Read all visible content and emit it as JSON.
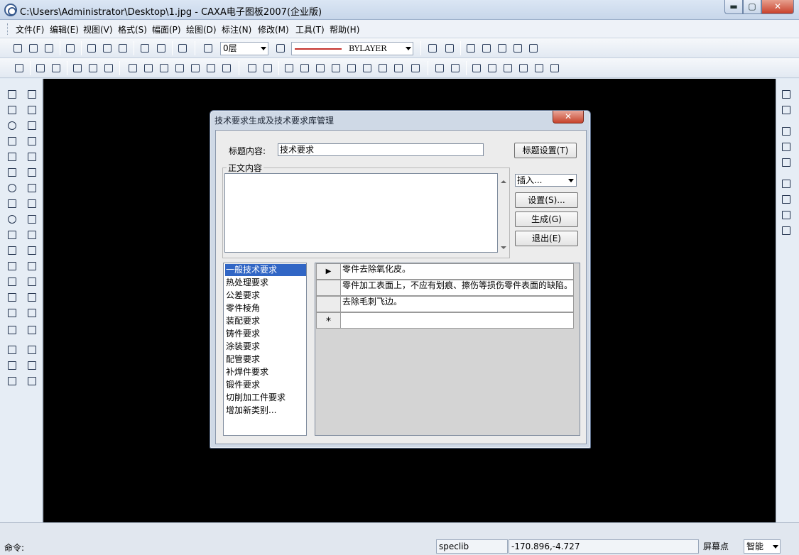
{
  "window": {
    "title": "C:\\Users\\Administrator\\Desktop\\1.jpg - CAXA电子图板2007(企业版)",
    "minimize": "▬",
    "maximize": "▢",
    "close": "✕"
  },
  "menu": [
    "文件(F)",
    "编辑(E)",
    "视图(V)",
    "格式(S)",
    "幅面(P)",
    "绘图(D)",
    "标注(N)",
    "修改(M)",
    "工具(T)",
    "帮助(H)"
  ],
  "toolbar": {
    "layer_value": "0层",
    "linetype_value": "BYLAYER"
  },
  "dialog": {
    "title": "技术要求生成及技术要求库管理",
    "close": "✕",
    "heading_label": "标题内容:",
    "heading_value": "技术要求",
    "heading_settings_button": "标题设置(T)",
    "body_group_label": "正文内容",
    "insert_combo": "插入...",
    "settings_button": "设置(S)...",
    "generate_button": "生成(G)",
    "exit_button": "退出(E)",
    "categories": [
      "一般技术要求",
      "热处理要求",
      "公差要求",
      "零件棱角",
      "装配要求",
      "铸件要求",
      "涂装要求",
      "配管要求",
      "补焊件要求",
      "锻件要求",
      "切削加工件要求",
      "增加新类别..."
    ],
    "selected_category_index": 0,
    "table_rows": [
      {
        "marker": "▶",
        "text": "零件去除氧化皮。"
      },
      {
        "marker": "",
        "text": "零件加工表面上，不应有划痕、擦伤等损伤零件表面的缺陷。"
      },
      {
        "marker": "",
        "text": "去除毛刺飞边。"
      },
      {
        "marker": "*",
        "text": ""
      }
    ]
  },
  "status": {
    "command_label": "命令:",
    "library": "speclib",
    "coordinates": "-170.896,-4.727",
    "snap_label": "屏幕点",
    "snap_mode": "智能"
  },
  "colors": {
    "canvas": "#000000",
    "selection": "#3166c5",
    "linetype_sample": "#c4322b"
  }
}
